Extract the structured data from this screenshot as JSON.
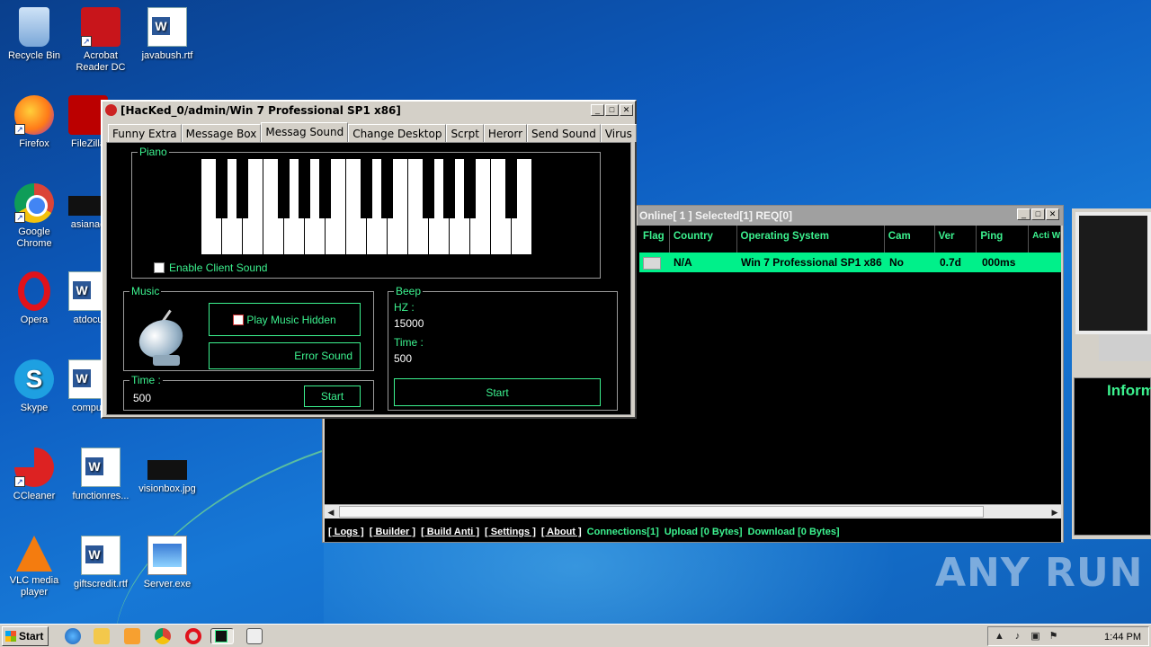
{
  "desktop": {
    "icons": [
      {
        "label": "Recycle Bin"
      },
      {
        "label": "Acrobat Reader DC"
      },
      {
        "label": "javabush.rtf"
      },
      {
        "label": "Firefox"
      },
      {
        "label": "FileZilla"
      },
      {
        "label": "Google Chrome"
      },
      {
        "label": "asianag"
      },
      {
        "label": "Opera"
      },
      {
        "label": "atdocu"
      },
      {
        "label": "Skype"
      },
      {
        "label": "comput"
      },
      {
        "label": "CCleaner"
      },
      {
        "label": "functionres..."
      },
      {
        "label": "visionbox.jpg"
      },
      {
        "label": "VLC media player"
      },
      {
        "label": "giftscredit.rtf"
      },
      {
        "label": "Server.exe"
      }
    ]
  },
  "rat_window": {
    "title": "Online[ 1 ]    Selected[1] REQ[0]",
    "columns": [
      "Flag",
      "Country",
      "Operating System",
      "Cam",
      "Ver",
      "Ping",
      "Acti Win"
    ],
    "row": {
      "flag": "",
      "country": "N/A",
      "os": "Win 7 Professional SP1 x86",
      "cam": "No",
      "ver": "0.7d",
      "ping": "000ms"
    },
    "status_links": [
      "[ Logs ]",
      "[ Builder ]",
      "[ Build Anti ]",
      "[ Settings ]",
      "[ About ]"
    ],
    "status_stats": [
      "Connections[1]",
      "Upload [0 Bytes]",
      "Download [0 Bytes]"
    ]
  },
  "info_window": {
    "label": "Inform"
  },
  "hack_window": {
    "title": "[HacKed_0/admin/Win 7 Professional SP1 x86]",
    "tabs": [
      "Funny Extra",
      "Message Box",
      "Messag Sound",
      "Change Desktop",
      "Scrpt",
      "Herorr",
      "Send Sound",
      "Virus"
    ],
    "active_tab": "Messag Sound",
    "piano": {
      "group_title": "Piano",
      "enable_label": "Enable Client Sound",
      "white_keys": 16
    },
    "music": {
      "group_title": "Music",
      "play_hidden": "Play Music Hidden",
      "error_sound": "Error Sound"
    },
    "time": {
      "group_title": "Time :",
      "value": "500",
      "start": "Start"
    },
    "beep": {
      "group_title": "Beep",
      "hz_label": "HZ :",
      "hz_value": "15000",
      "time_label": "Time :",
      "time_value": "500",
      "start": "Start"
    }
  },
  "taskbar": {
    "start_label": "Start",
    "clock": "1:44 PM"
  },
  "watermark": "ANY RUN"
}
